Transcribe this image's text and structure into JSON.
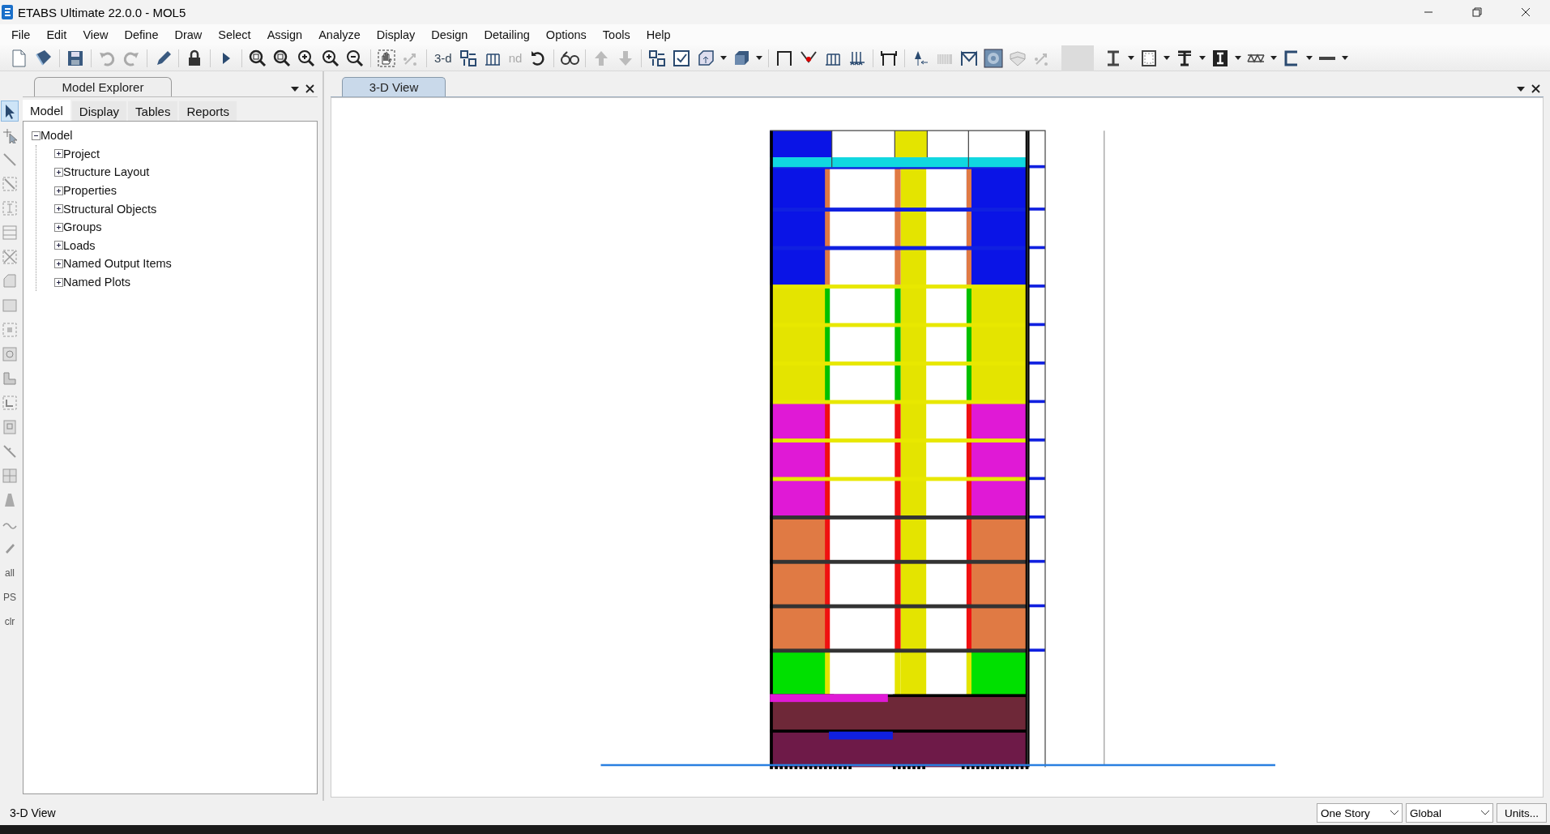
{
  "window": {
    "title": "ETABS Ultimate 22.0.0 - MOL5"
  },
  "menu": [
    "File",
    "Edit",
    "View",
    "Define",
    "Draw",
    "Select",
    "Assign",
    "Analyze",
    "Display",
    "Design",
    "Detailing",
    "Options",
    "Tools",
    "Help"
  ],
  "toolbar_text_buttons": [
    {
      "label": "3-d",
      "disabled": false
    },
    {
      "label": "nd",
      "disabled": true
    }
  ],
  "draw_tool_labels": [
    "all",
    "PS",
    "clr"
  ],
  "model_explorer": {
    "title": "Model Explorer",
    "tabs": [
      {
        "label": "Model",
        "selected": true
      },
      {
        "label": "Display",
        "selected": false
      },
      {
        "label": "Tables",
        "selected": false
      },
      {
        "label": "Reports",
        "selected": false
      }
    ],
    "tree": [
      {
        "label": "Model",
        "expanded": true,
        "children": [
          {
            "label": "Project",
            "expanded": false
          },
          {
            "label": "Structure Layout",
            "expanded": false
          },
          {
            "label": "Properties",
            "expanded": false
          },
          {
            "label": "Structural Objects",
            "expanded": false
          },
          {
            "label": "Groups",
            "expanded": false
          },
          {
            "label": "Loads",
            "expanded": false
          },
          {
            "label": "Named Output Items",
            "expanded": false
          },
          {
            "label": "Named Plots",
            "expanded": false
          }
        ]
      }
    ]
  },
  "view_tabs": [
    {
      "label": "3-D View",
      "selected": true
    }
  ],
  "status_bar": {
    "text": "3-D View",
    "story_select": "One Story",
    "coord_select": "Global",
    "units_button": "Units..."
  }
}
